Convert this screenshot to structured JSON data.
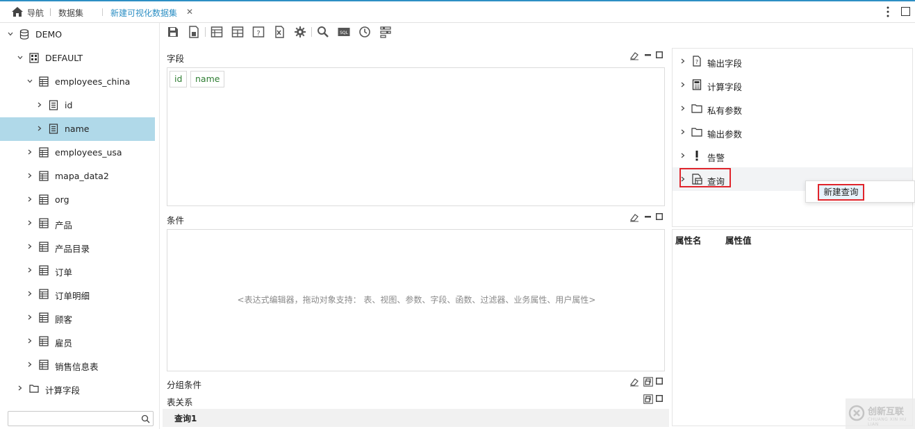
{
  "tabs": {
    "nav": "导航",
    "dataset": "数据集",
    "active": "新建可视化数据集",
    "close": "✕"
  },
  "tree": {
    "items": [
      {
        "label": "DEMO"
      },
      {
        "label": "DEFAULT"
      },
      {
        "label": "employees_china"
      },
      {
        "label": "id"
      },
      {
        "label": "name"
      },
      {
        "label": "employees_usa"
      },
      {
        "label": "mapa_data2"
      },
      {
        "label": "org"
      },
      {
        "label": "产品"
      },
      {
        "label": "产品目录"
      },
      {
        "label": "订单"
      },
      {
        "label": "订单明细"
      },
      {
        "label": "顾客"
      },
      {
        "label": "雇员"
      },
      {
        "label": "销售信息表"
      },
      {
        "label": "计算字段"
      }
    ],
    "search_value": ""
  },
  "sections": {
    "fields": "字段",
    "conditions": "条件",
    "group": "分组条件",
    "relations": "表关系"
  },
  "fields": [
    "id",
    "name"
  ],
  "conditions_placeholder": "<表达式编辑器，拖动对象支持： 表、视图、参数、字段、函数、过滤器、业务属性、用户属性>",
  "relations_tab": "查询1",
  "right_tree": [
    {
      "label": "输出字段",
      "icon": "output-field-icon"
    },
    {
      "label": "计算字段",
      "icon": "calculator-icon"
    },
    {
      "label": "私有参数",
      "icon": "folder-icon"
    },
    {
      "label": "输出参数",
      "icon": "folder-icon"
    },
    {
      "label": "告警",
      "icon": "exclamation-icon"
    },
    {
      "label": "查询",
      "icon": "query-icon"
    }
  ],
  "context_menu": {
    "new_query": "新建查询"
  },
  "properties": {
    "name_header": "属性名",
    "value_header": "属性值"
  },
  "watermark": {
    "text": "创新互联",
    "sub": "CHUANG XIN HU LIAN"
  },
  "colors": {
    "accent": "#2d8fc4",
    "selected_row": "#b0d9e9",
    "highlight": "#e0242b",
    "field_text": "#2e7d32"
  }
}
